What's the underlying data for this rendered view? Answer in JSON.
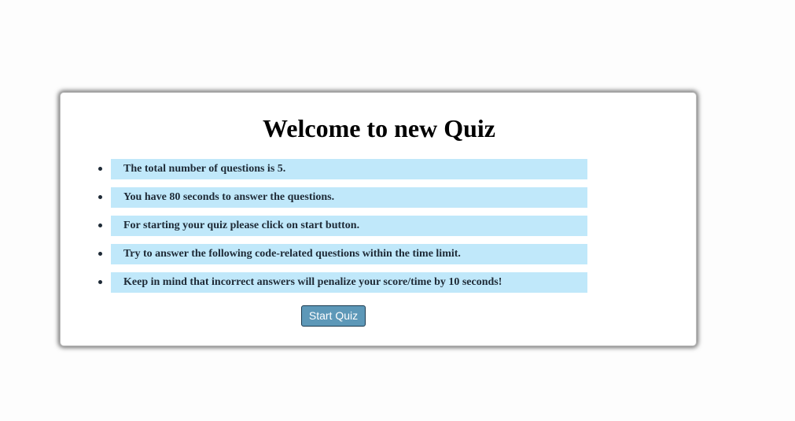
{
  "quiz": {
    "title": "Welcome to new Quiz",
    "rules": [
      "The total number of questions is 5.",
      "You have 80 seconds to answer the questions.",
      "For starting your quiz please click on start button.",
      "Try to answer the following code-related questions within the time limit.",
      "Keep in mind that incorrect answers will penalize your score/time by 10 seconds!"
    ],
    "start_button_label": "Start Quiz"
  },
  "colors": {
    "page_background": "#fdfdfd",
    "card_background": "#ffffff",
    "rule_highlight": "#c0e8fa",
    "rule_text": "#1e2a36",
    "button_background": "#5d98b8",
    "button_border": "#1b3a4f",
    "button_text": "#ffffff"
  },
  "icons": {
    "bullet": "bullet-dot-icon"
  }
}
